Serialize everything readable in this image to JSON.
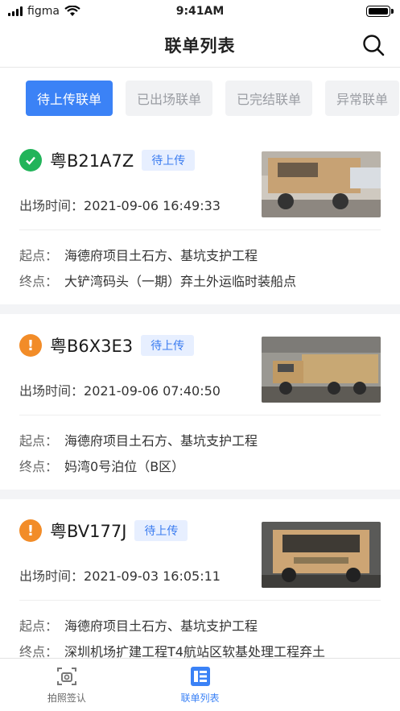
{
  "status_bar": {
    "carrier": "figma",
    "time": "9:41AM"
  },
  "nav": {
    "title": "联单列表"
  },
  "tabs": [
    {
      "label": "待上传联单",
      "active": true
    },
    {
      "label": "已出场联单",
      "active": false
    },
    {
      "label": "已完结联单",
      "active": false
    },
    {
      "label": "异常联单",
      "active": false
    }
  ],
  "cards": [
    {
      "status": "ok",
      "plate": "粤B21A7Z",
      "badge": "待上传",
      "exit_label": "出场时间：",
      "exit_time": "2021-09-06 16:49:33",
      "start_label": "起点：",
      "start": "海德府项目土石方、基坑支护工程",
      "end_label": "终点：",
      "end": "大铲湾码头（一期）弃土外运临时装船点"
    },
    {
      "status": "warn",
      "plate": "粤B6X3E3",
      "badge": "待上传",
      "exit_label": "出场时间：",
      "exit_time": "2021-09-06 07:40:50",
      "start_label": "起点：",
      "start": "海德府项目土石方、基坑支护工程",
      "end_label": "终点：",
      "end": "妈湾0号泊位（B区）"
    },
    {
      "status": "warn",
      "plate": "粤BV177J",
      "badge": "待上传",
      "exit_label": "出场时间：",
      "exit_time": "2021-09-03 16:05:11",
      "start_label": "起点：",
      "start": "海德府项目土石方、基坑支护工程",
      "end_label": "终点：",
      "end": "深圳机场扩建工程T4航站区软基处理工程弃土"
    }
  ],
  "bottom_nav": [
    {
      "label": "拍照签认",
      "icon": "camera-icon",
      "active": false
    },
    {
      "label": "联单列表",
      "icon": "list-icon",
      "active": true
    }
  ],
  "colors": {
    "primary": "#3b82f6",
    "ok": "#22b45a",
    "warn": "#f28c28"
  }
}
